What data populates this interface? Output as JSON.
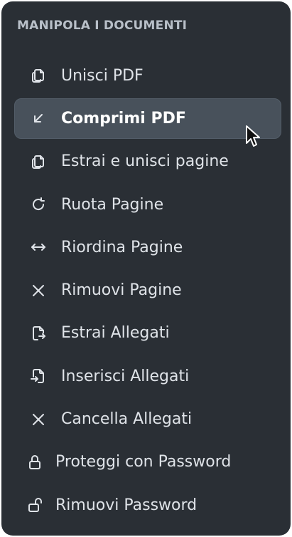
{
  "section": {
    "title": "MANIPOLA I DOCUMENTI"
  },
  "menu": {
    "items": [
      {
        "label": "Unisci PDF",
        "icon": "copy-icon"
      },
      {
        "label": "Comprimi PDF",
        "icon": "arrow-down-left-icon",
        "active": true
      },
      {
        "label": "Estrai e unisci pagine",
        "icon": "copy-icon"
      },
      {
        "label": "Ruota Pagine",
        "icon": "rotate-icon"
      },
      {
        "label": "Riordina Pagine",
        "icon": "arrows-horizontal-icon"
      },
      {
        "label": "Rimuovi Pagine",
        "icon": "x-icon"
      },
      {
        "label": "Estrai Allegati",
        "icon": "file-export-icon"
      },
      {
        "label": "Inserisci Allegati",
        "icon": "file-import-icon"
      },
      {
        "label": "Cancella Allegati",
        "icon": "x-icon"
      },
      {
        "label": "Proteggi con Password",
        "icon": "lock-icon"
      },
      {
        "label": "Rimuovi Password",
        "icon": "unlock-icon"
      }
    ]
  },
  "colors": {
    "panel": "#2a2f35",
    "highlight": "#48515b",
    "text": "#dfe3e8",
    "title": "#b8bfc8"
  }
}
